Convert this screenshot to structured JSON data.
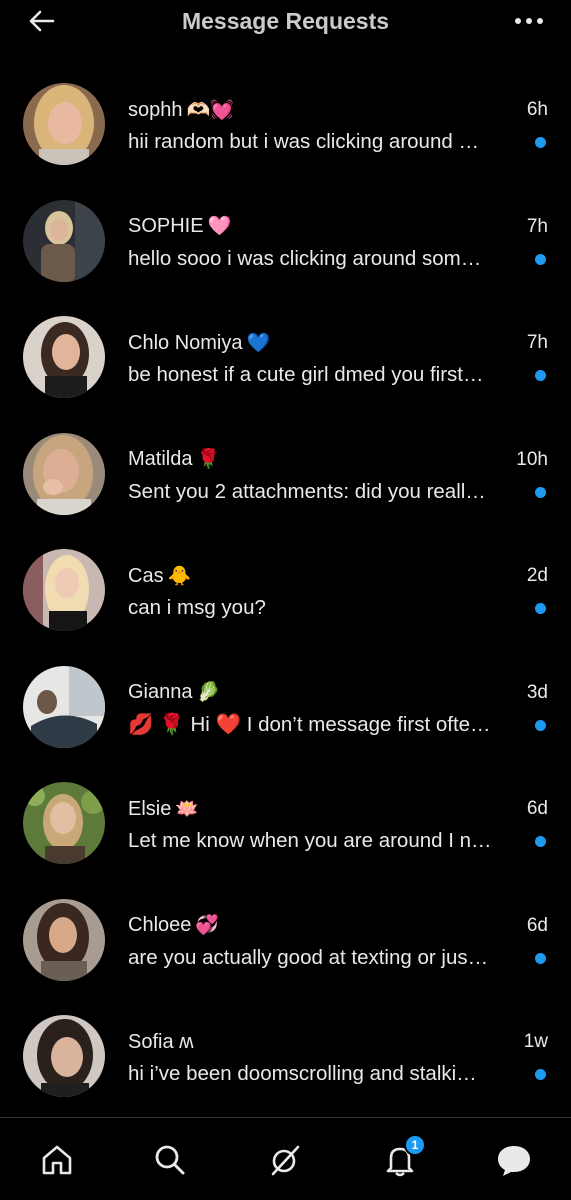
{
  "header": {
    "title": "Message Requests"
  },
  "colors": {
    "accent": "#1d9bf0",
    "background": "#000000",
    "text": "#e7e9ea"
  },
  "requests": [
    {
      "name": "sophh",
      "emoji": "🫶🏻💓",
      "time": "6h",
      "preview": "hii random but i was clicking around …",
      "unread": true
    },
    {
      "name": "SOPHIE",
      "emoji": "🩷",
      "time": "7h",
      "preview": "hello sooo i was clicking around som…",
      "unread": true
    },
    {
      "name": "Chlo Nomiya",
      "emoji": "💙",
      "time": "7h",
      "preview": "be honest if a cute girl dmed you first…",
      "unread": true
    },
    {
      "name": "Matilda",
      "emoji": "🌹",
      "time": "10h",
      "preview": "Sent you 2 attachments: did you reall…",
      "unread": true
    },
    {
      "name": "Cas",
      "emoji": "🐥",
      "time": "2d",
      "preview": "can i msg you?",
      "unread": true
    },
    {
      "name": "Gianna",
      "emoji": "🥬",
      "time": "3d",
      "preview": "💋 🌹 Hi ❤️ I don’t message first ofte…",
      "unread": true
    },
    {
      "name": "Elsie",
      "emoji": "🪷",
      "time": "6d",
      "preview": "Let me know when you are around I n…",
      "unread": true
    },
    {
      "name": "Chloee",
      "emoji": "💞",
      "time": "6d",
      "preview": "are you actually good at texting or jus…",
      "unread": true
    },
    {
      "name": "Sofia ʍ",
      "emoji": "",
      "time": "1w",
      "preview": "hi i’ve been doomscrolling and stalki…",
      "unread": true
    }
  ],
  "nav": {
    "items": [
      {
        "icon": "home-icon"
      },
      {
        "icon": "search-icon"
      },
      {
        "icon": "grok-icon"
      },
      {
        "icon": "notifications-icon",
        "badge": "1"
      },
      {
        "icon": "messages-icon"
      }
    ]
  }
}
